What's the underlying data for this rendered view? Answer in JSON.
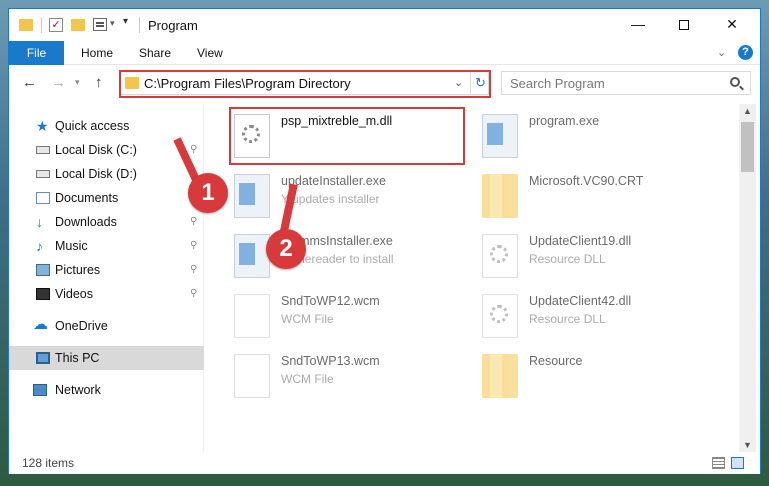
{
  "window": {
    "title": "Program",
    "minimize": "—",
    "close": "✕"
  },
  "ribbon": {
    "tabs": [
      "File",
      "Home",
      "Share",
      "View"
    ],
    "help": "?"
  },
  "navigation": {
    "address": "C:\\Program Files\\Program Directory",
    "search_placeholder": "Search Program"
  },
  "sidebar": {
    "items": [
      {
        "label": "Quick access",
        "icon": "star-icon",
        "pinned": false
      },
      {
        "label": "Local Disk (C:)",
        "icon": "drive-icon",
        "pinned": true
      },
      {
        "label": "Local Disk (D:)",
        "icon": "drive-icon",
        "pinned": true
      },
      {
        "label": "Documents",
        "icon": "documents-icon",
        "pinned": true
      },
      {
        "label": "Downloads",
        "icon": "downloads-icon",
        "pinned": true
      },
      {
        "label": "Music",
        "icon": "music-icon",
        "pinned": true
      },
      {
        "label": "Pictures",
        "icon": "pictures-icon",
        "pinned": true
      },
      {
        "label": "Videos",
        "icon": "videos-icon",
        "pinned": true
      },
      {
        "label": "OneDrive",
        "icon": "onedrive-icon",
        "pinned": false
      },
      {
        "label": "This PC",
        "icon": "pc-icon",
        "pinned": false,
        "selected": true
      },
      {
        "label": "Network",
        "icon": "network-icon",
        "pinned": false
      }
    ]
  },
  "files": [
    {
      "name": "psp_mixtreble_m.dll",
      "desc": "",
      "icon": "dll-icon"
    },
    {
      "name": "program.exe",
      "desc": "",
      "icon": "exe-icon"
    },
    {
      "name": "updateInstaller.exe",
      "desc": "Y updates installer",
      "icon": "exe-icon"
    },
    {
      "name": "Microsoft.VC90.CRT",
      "desc": "",
      "icon": "folder-icon"
    },
    {
      "name": "grammsInstaller.exe",
      "desc": "Y finereader to install",
      "icon": "exe-icon"
    },
    {
      "name": "UpdateClient19.dll",
      "desc": "Resource DLL",
      "icon": "dll-icon"
    },
    {
      "name": "SndToWP12.wcm",
      "desc": "WCM File",
      "icon": "file-icon"
    },
    {
      "name": "UpdateClient42.dll",
      "desc": "Resource DLL",
      "icon": "dll-icon"
    },
    {
      "name": "SndToWP13.wcm",
      "desc": "WCM File",
      "icon": "file-icon"
    },
    {
      "name": "Resource",
      "desc": "",
      "icon": "folder-icon"
    }
  ],
  "callouts": [
    "1",
    "2"
  ],
  "status": {
    "item_count": "128 items"
  },
  "colors": {
    "accent": "#1979ca",
    "highlight": "#d8393a"
  }
}
